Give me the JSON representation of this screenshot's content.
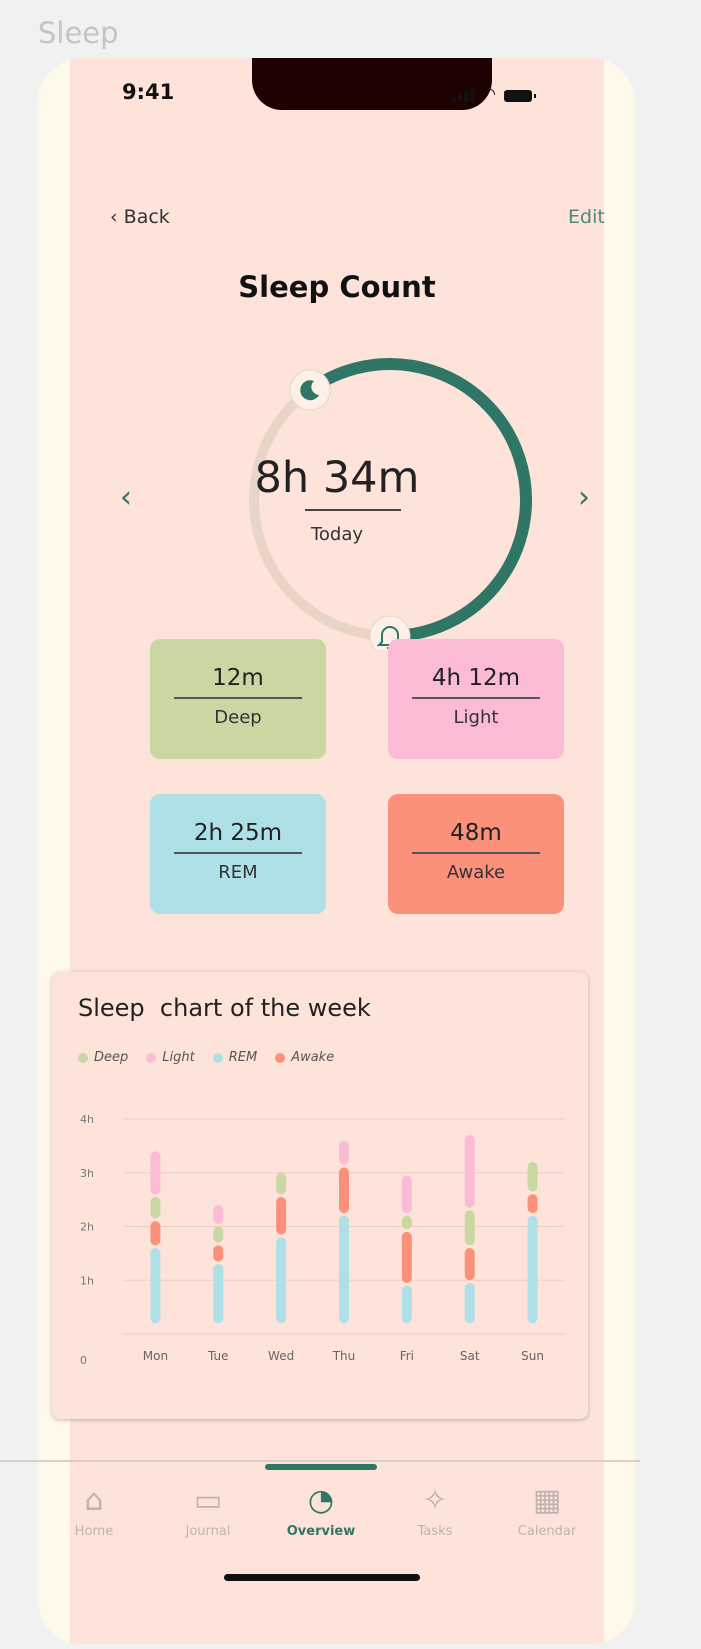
{
  "frame_label": "Sleep",
  "status_bar": {
    "time": "9:41"
  },
  "header": {
    "back_label": "Back",
    "edit_label": "Edit",
    "title": "Sleep Count"
  },
  "sleep_ring": {
    "total": "8h 34m",
    "period": "Today",
    "progress_fraction": 0.6,
    "colors": {
      "track": "#e8d5c8",
      "progress": "#2f7666"
    }
  },
  "cards": [
    {
      "value": "12m",
      "label": "Deep",
      "color": "#c9d8a2"
    },
    {
      "value": "4h 12m",
      "label": "Light",
      "color": "#fbbbd7"
    },
    {
      "value": "2h 25m",
      "label": "REM",
      "color": "#aee0e8"
    },
    {
      "value": "48m",
      "label": "Awake",
      "color": "#fb917a"
    }
  ],
  "chart_data": {
    "type": "bar",
    "title": "Sleep  chart of the week",
    "legend": [
      {
        "name": "Deep",
        "color": "#c9d8a2"
      },
      {
        "name": "Light",
        "color": "#fbbbd7"
      },
      {
        "name": "REM",
        "color": "#aee0e8"
      },
      {
        "name": "Awake",
        "color": "#fb917a"
      }
    ],
    "categories": [
      "Mon",
      "Tue",
      "Wed",
      "Thu",
      "Fri",
      "Sat",
      "Sun"
    ],
    "y_ticks": [
      "0",
      "1h",
      "2h",
      "3h",
      "4h"
    ],
    "ylim": [
      0,
      4
    ],
    "grid": true,
    "segments": [
      [
        {
          "name": "REM",
          "from": 0.2,
          "to": 1.6
        },
        {
          "name": "Awake",
          "from": 1.65,
          "to": 2.1
        },
        {
          "name": "Deep",
          "from": 2.15,
          "to": 2.55
        },
        {
          "name": "Light",
          "from": 2.6,
          "to": 3.4
        }
      ],
      [
        {
          "name": "REM",
          "from": 0.2,
          "to": 1.3
        },
        {
          "name": "Awake",
          "from": 1.35,
          "to": 1.65
        },
        {
          "name": "Deep",
          "from": 1.7,
          "to": 2.0
        },
        {
          "name": "Light",
          "from": 2.05,
          "to": 2.4
        }
      ],
      [
        {
          "name": "REM",
          "from": 0.2,
          "to": 1.8
        },
        {
          "name": "Awake",
          "from": 1.85,
          "to": 2.55
        },
        {
          "name": "Deep",
          "from": 2.6,
          "to": 3.0
        }
      ],
      [
        {
          "name": "REM",
          "from": 0.2,
          "to": 2.2
        },
        {
          "name": "Awake",
          "from": 2.25,
          "to": 3.1
        },
        {
          "name": "Light",
          "from": 3.15,
          "to": 3.6
        }
      ],
      [
        {
          "name": "REM",
          "from": 0.2,
          "to": 0.9
        },
        {
          "name": "Awake",
          "from": 0.95,
          "to": 1.9
        },
        {
          "name": "Deep",
          "from": 1.95,
          "to": 2.2
        },
        {
          "name": "Light",
          "from": 2.25,
          "to": 2.95
        }
      ],
      [
        {
          "name": "REM",
          "from": 0.2,
          "to": 0.95
        },
        {
          "name": "Awake",
          "from": 1.0,
          "to": 1.6
        },
        {
          "name": "Deep",
          "from": 1.65,
          "to": 2.3
        },
        {
          "name": "Light",
          "from": 2.35,
          "to": 3.7
        }
      ],
      [
        {
          "name": "REM",
          "from": 0.2,
          "to": 2.2
        },
        {
          "name": "Awake",
          "from": 2.25,
          "to": 2.6
        },
        {
          "name": "Deep",
          "from": 2.65,
          "to": 3.2
        }
      ]
    ]
  },
  "tabs": [
    {
      "label": "Home",
      "icon": "home-icon",
      "active": false
    },
    {
      "label": "Journal",
      "icon": "journal-icon",
      "active": false
    },
    {
      "label": "Overview",
      "icon": "pie-chart-icon",
      "active": true
    },
    {
      "label": "Tasks",
      "icon": "puzzle-icon",
      "active": false
    },
    {
      "label": "Calendar",
      "icon": "calendar-icon",
      "active": false
    }
  ]
}
